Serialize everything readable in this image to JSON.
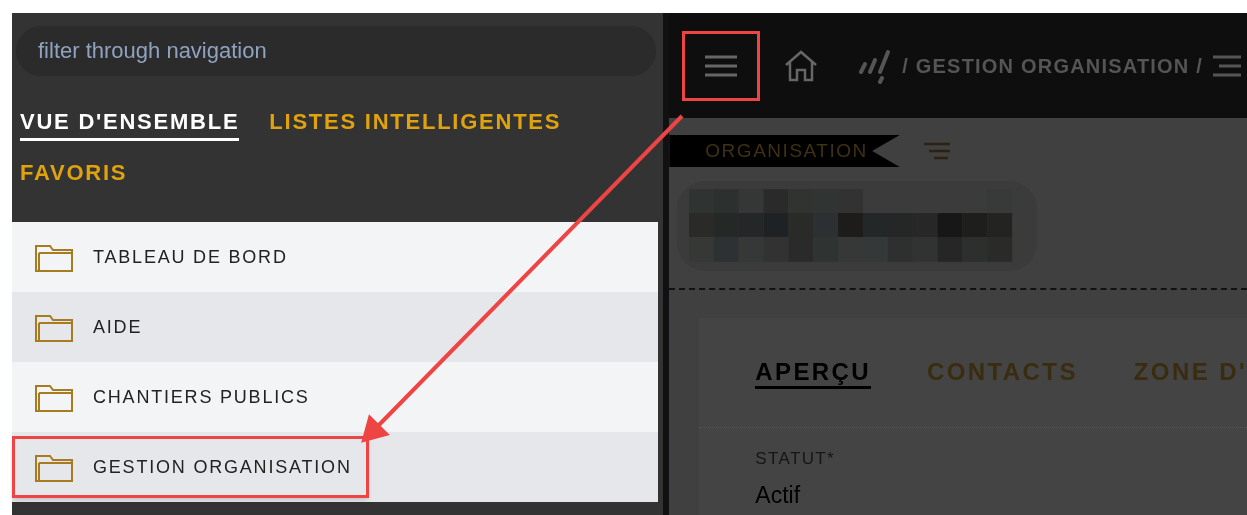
{
  "sidebar": {
    "search": {
      "placeholder": "filter through navigation"
    },
    "tabs": [
      {
        "label": "VUE D'ENSEMBLE",
        "selected": true
      },
      {
        "label": "LISTES INTELLIGENTES",
        "selected": false
      },
      {
        "label": "FAVORIS",
        "selected": false
      }
    ],
    "items": [
      {
        "label": "TABLEAU DE BORD",
        "highlighted": false
      },
      {
        "label": "AIDE",
        "highlighted": false
      },
      {
        "label": "CHANTIERS PUBLICS",
        "highlighted": false
      },
      {
        "label": "GESTION ORGANISATION",
        "highlighted": true
      }
    ]
  },
  "topbar": {
    "menu_highlighted": true,
    "breadcrumb": "/ GESTION ORGANISATION /"
  },
  "content": {
    "section_label": "ORGANISATION",
    "tabs": [
      {
        "label": "APERÇU",
        "selected": true
      },
      {
        "label": "CONTACTS",
        "selected": false
      },
      {
        "label": "ZONE D'",
        "selected": false
      }
    ],
    "fields": [
      {
        "label": "STATUT*",
        "value": "Actif"
      }
    ]
  }
}
